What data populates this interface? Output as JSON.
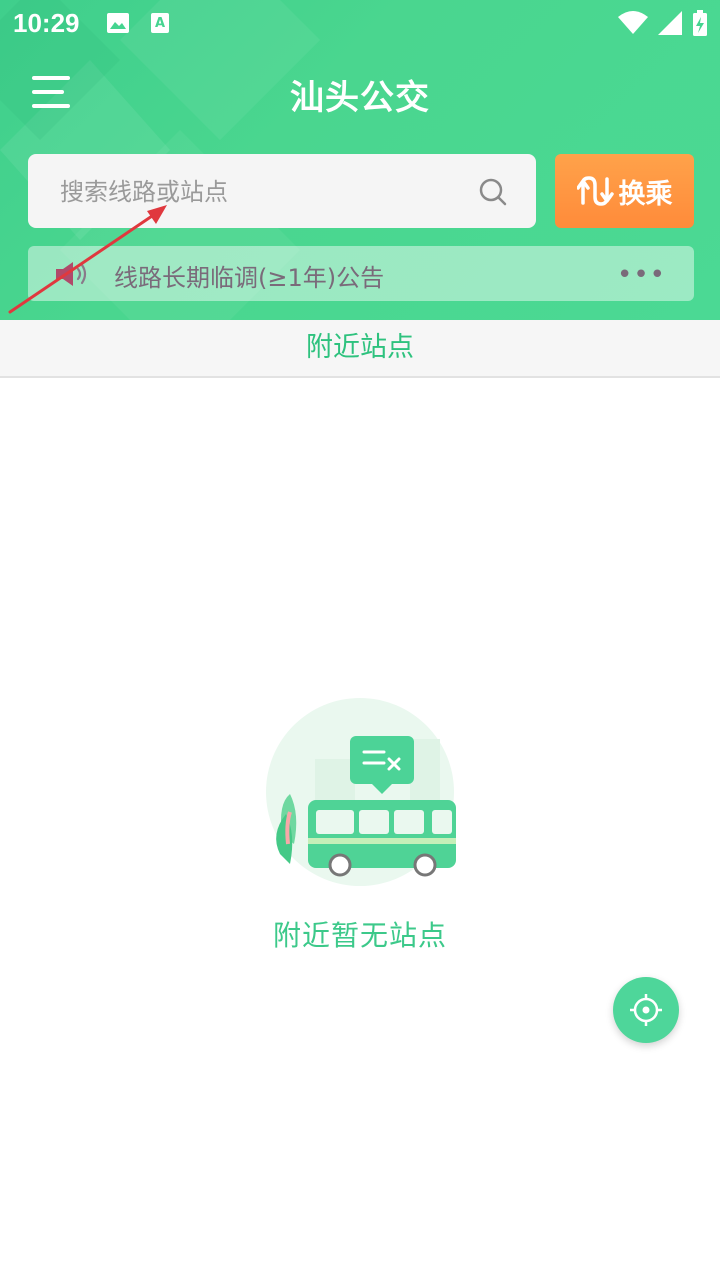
{
  "status_bar": {
    "time": "10:29",
    "left_icons": [
      "image-icon",
      "a-notification-icon"
    ],
    "right_icons": [
      "wifi-icon",
      "signal-icon",
      "battery-charging-icon"
    ]
  },
  "header": {
    "title": "汕头公交",
    "menu_icon": "menu-icon"
  },
  "search": {
    "placeholder": "搜索线路或站点",
    "value": "",
    "icon": "search-icon"
  },
  "transfer_button": {
    "label": "换乘",
    "icon": "transfer-arrows-icon"
  },
  "notice": {
    "icon": "speaker-icon",
    "text": "线路长期临调(≥1年)公告",
    "more_label": "•••"
  },
  "nearby": {
    "tab_label": "附近站点",
    "empty_text": "附近暂无站点",
    "illustration": "bus-illustration"
  },
  "locate_button": {
    "icon": "locate-crosshair-icon"
  },
  "colors": {
    "primary_green": "#4ad68f",
    "accent_orange": "#ff8b3a",
    "tab_text_green": "#2ec27e",
    "annotation_red": "#e0383e"
  }
}
